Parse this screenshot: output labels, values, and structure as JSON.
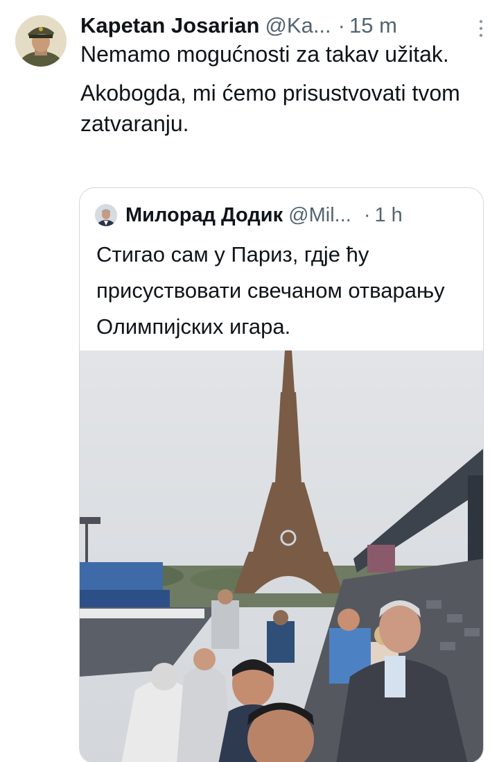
{
  "tweet": {
    "author_name": "Kapetan Josarian",
    "author_handle": "@Ka...",
    "separator": "·",
    "time": "15 m",
    "paragraphs": [
      "Nemamo mogućnosti za takav užitak.",
      "Akobogda, mi ćemo prisustvovati tvom zatvaranju."
    ]
  },
  "quoted_tweet": {
    "author_name": "Милорад Додик",
    "author_handle": "@Mil...",
    "separator": "·",
    "time": "1 h",
    "text": "Стигао сам у Париз, гдје ћу присуствовати свечаном отварању Олимпијских игара."
  },
  "icons": {
    "more": "more-vertical-icon",
    "author_avatar": "avatar-icon",
    "quoted_avatar": "avatar-icon"
  },
  "colors": {
    "text_primary": "#0f1419",
    "text_secondary": "#536471",
    "border": "#cfd9de"
  }
}
